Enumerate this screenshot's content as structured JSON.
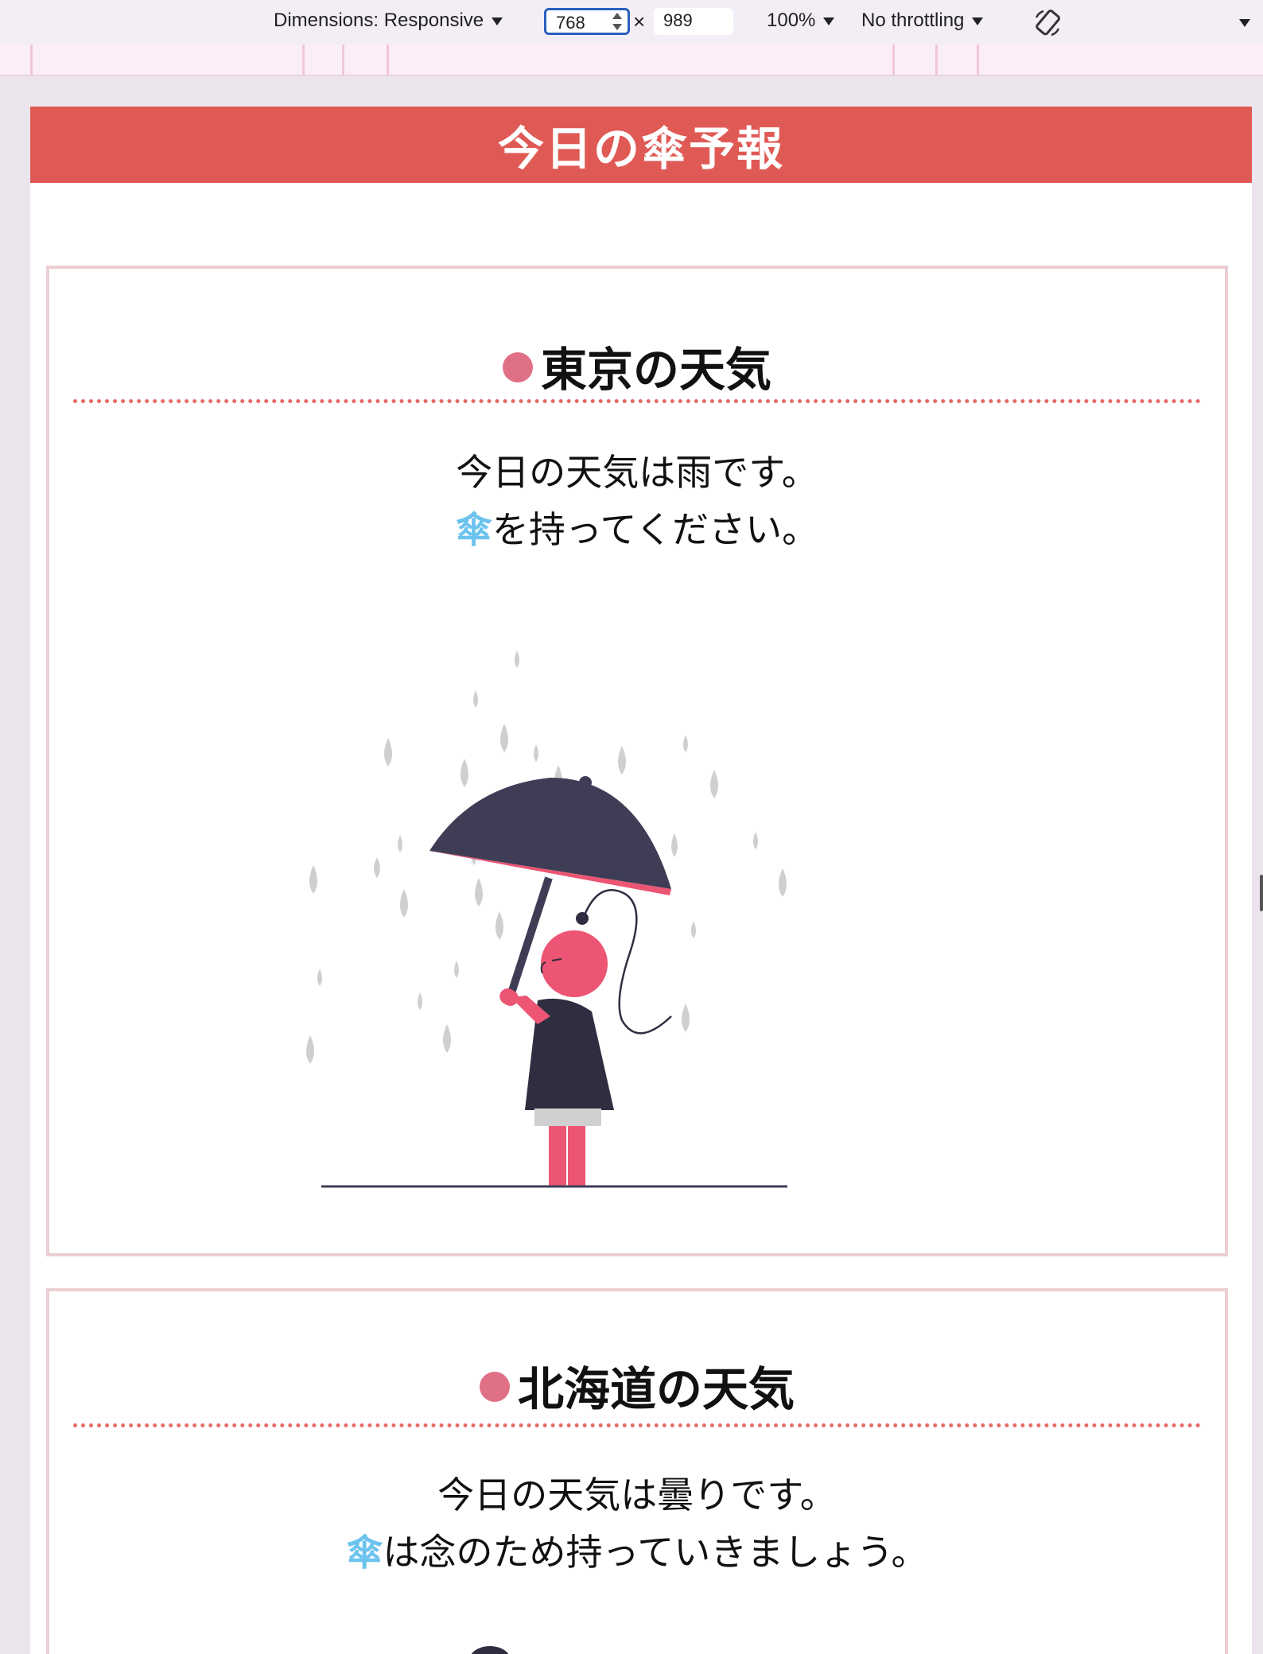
{
  "devtools": {
    "dimensions_label": "Dimensions: Responsive",
    "width_value": "768",
    "times_symbol": "×",
    "height_value": "989",
    "zoom_label": "100%",
    "throttling_label": "No throttling",
    "rotate_icon": "rotate-icon",
    "more_icon": "caret-down-icon"
  },
  "site": {
    "title": "今日の傘予報"
  },
  "cards": [
    {
      "title": "東京の天気",
      "line1": "今日の天気は雨です。",
      "umbrella": "傘",
      "line2_rest": "を持ってください。",
      "illustration": "woman-with-umbrella-in-rain"
    },
    {
      "title": "北海道の天気",
      "line1": "今日の天気は曇りです。",
      "umbrella": "傘",
      "line2_rest": "は念のため持っていきましょう。",
      "illustration": "cloudy-illustration-partial"
    }
  ],
  "colors": {
    "header_bg": "#e05a55",
    "card_border": "#eccfd3",
    "title_dot": "#e07085",
    "dotted_rule": "#e46b66",
    "umbrella_text": "#6cc3ee",
    "figure_pink": "#ec5573",
    "figure_dark": "#3f3d56"
  }
}
